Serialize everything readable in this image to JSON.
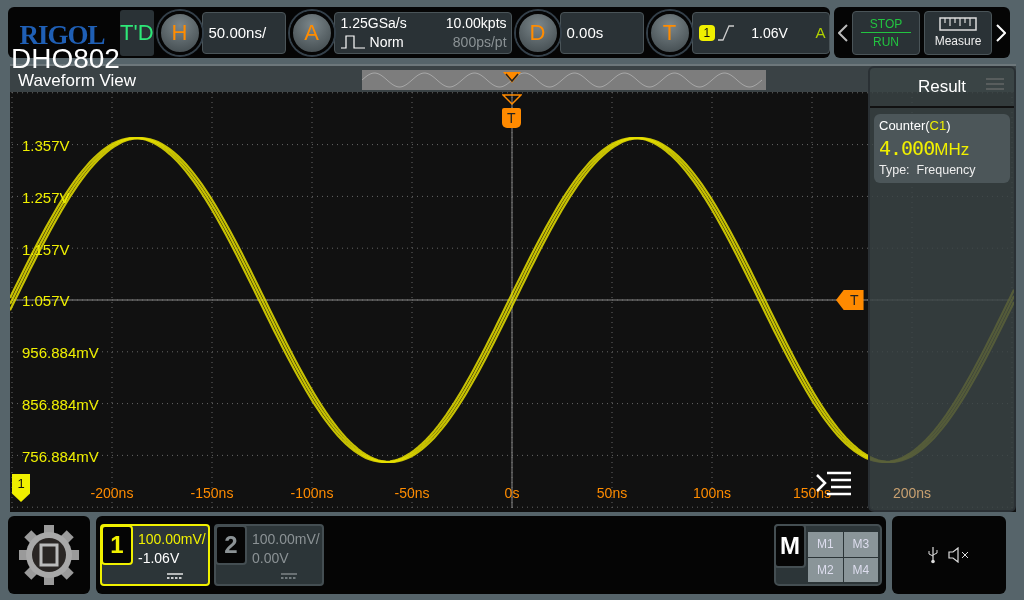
{
  "logo": {
    "brand": "RIGOL",
    "model": "DHO802"
  },
  "run_state": "T'D",
  "horizontal": {
    "key": "H",
    "scale": "50.00ns/"
  },
  "acquire": {
    "key": "A",
    "sample_rate": "1.25GSa/s",
    "mode": "Norm",
    "memory_depth": "10.00kpts",
    "resolution": "800ps/pt"
  },
  "delay": {
    "key": "D",
    "value": "0.00s"
  },
  "trigger": {
    "key": "T",
    "source": "1",
    "level": "1.06V",
    "sweep": "A"
  },
  "run_control": {
    "stop": "STOP",
    "run": "RUN"
  },
  "measure_button": "Measure",
  "waveform_view": {
    "title": "Waveform View",
    "trigger_position_marker": "T",
    "trigger_level_marker": "T",
    "channel_marker": "1",
    "y_labels": [
      "1.357V",
      "1.257V",
      "1.157V",
      "1.057V",
      "956.884mV",
      "856.884mV",
      "756.884mV"
    ],
    "x_labels": [
      "-200ns",
      "-150ns",
      "-100ns",
      "-50ns",
      "0s",
      "50ns",
      "100ns",
      "150ns",
      "200ns"
    ]
  },
  "result_panel": {
    "title": "Result",
    "counter": {
      "label_prefix": "Counter(",
      "source": "C1",
      "label_suffix": ")",
      "value": "4.000",
      "unit": "MHz",
      "type_label": "Type:",
      "type_value": "Frequency"
    }
  },
  "channels": [
    {
      "number": "1",
      "scale": "100.00mV/",
      "offset": "-1.06V",
      "on": true
    },
    {
      "number": "2",
      "scale": "100.00mV/",
      "offset": "0.00V",
      "on": false
    }
  ],
  "math": {
    "key": "M",
    "slots": [
      "M1",
      "M3",
      "M2",
      "M4"
    ]
  }
}
